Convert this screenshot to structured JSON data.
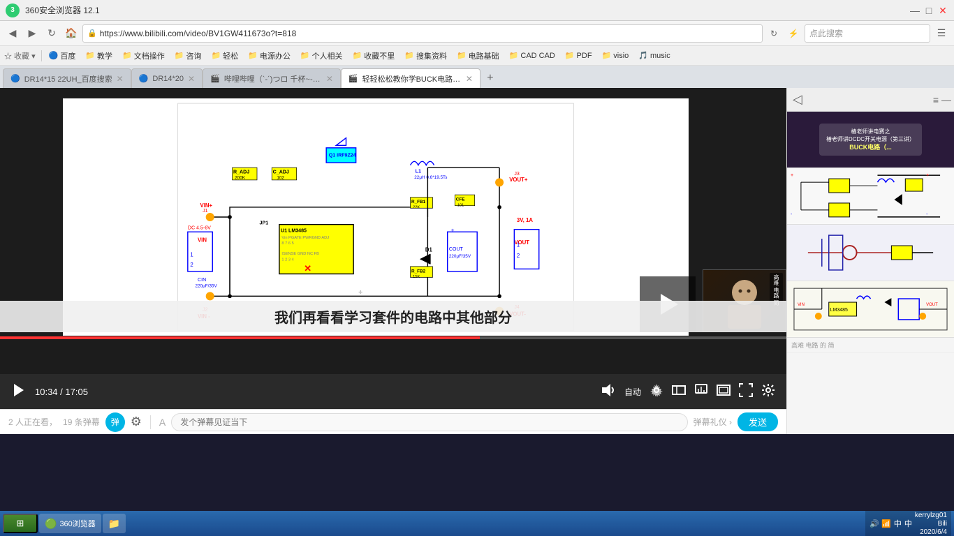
{
  "titleBar": {
    "title": "360安全浏览器 12.1",
    "controls": [
      "—",
      "□",
      "×"
    ]
  },
  "navBar": {
    "url": "https://www.bilibili.com/video/BV1GW411673o?t=818",
    "searchPlaceholder": "点此搜索"
  },
  "bookmarks": [
    {
      "label": "收藏",
      "icon": "★"
    },
    {
      "label": "百度",
      "icon": "🔵"
    },
    {
      "label": "教学",
      "icon": "📁"
    },
    {
      "label": "文档操作",
      "icon": "📁"
    },
    {
      "label": "咨询",
      "icon": "📁"
    },
    {
      "label": "轻松",
      "icon": "📁"
    },
    {
      "label": "电源办公",
      "icon": "📁"
    },
    {
      "label": "个人相关",
      "icon": "📁"
    },
    {
      "label": "收藏不里",
      "icon": "📁"
    },
    {
      "label": "搜集资料",
      "icon": "📁"
    },
    {
      "label": "电路基础",
      "icon": "📁"
    },
    {
      "label": "CAD",
      "icon": "📁"
    },
    {
      "label": "PDF",
      "icon": "📁"
    },
    {
      "label": "visio",
      "icon": "📁"
    },
    {
      "label": "music",
      "icon": "📁"
    }
  ],
  "tabs": [
    {
      "label": "DR14*15 22UH_百度搜索",
      "active": false
    },
    {
      "label": "DR14*20",
      "active": false
    },
    {
      "label": "哔哩哔哩（`-´)つロ 千杯~-bili...",
      "active": false
    },
    {
      "label": "轻轻松松教你学BUCK电路_哔哩...",
      "active": true
    }
  ],
  "video": {
    "currentTime": "10:34",
    "totalTime": "17:05",
    "subtitle": "我们再看看学习套件的电路中其他部分",
    "autoLabel": "自动",
    "viewerCount": "2 人正在看，",
    "danmakuCount": "19 条弹幕",
    "danmakuPlaceholder": "发个弹幕见证当下",
    "danmakuProtocol": "弹幕礼仪 ›",
    "sendBtn": "发送",
    "progressPercent": 61
  },
  "sidebar": {
    "items": [
      {
        "title": "椿老师讲电赛之 椿老师讲DCDC开关电源（第三讲） BUCK电路（..."
      },
      {
        "title": "circuit diagram 2"
      },
      {
        "title": "circuit diagram 3"
      },
      {
        "title": "circuit diagram 4"
      }
    ]
  },
  "circuit": {
    "title": "BUCK Circuit Schematic",
    "components": {
      "Q1": "IRF9Z24",
      "L1": "22μH 0.6*19.5Ts",
      "D1": "D1",
      "U1": "LM3485",
      "CIN": "220μF/35V",
      "COUT": "220μF/35V",
      "CFE": "101",
      "R_ADJ": "200K",
      "C_ADJ": "102",
      "R_FB1": "22K",
      "R_FB2": "15K",
      "VIN_range": "DC 4.5-6V",
      "VOUT_spec": "3V, 1A",
      "J1": "J1",
      "J2": "J2",
      "J3": "J3",
      "J4": "J4",
      "JP1": "JP1"
    }
  },
  "taskbar": {
    "startLabel": "开始",
    "apps": [
      {
        "label": "360浏览器",
        "icon": "🟢"
      },
      {
        "label": "资源管理器",
        "icon": "📁"
      }
    ],
    "tray": {
      "user": "kerrylzg01",
      "platform": "Bili",
      "date": "2020/6/4"
    }
  }
}
